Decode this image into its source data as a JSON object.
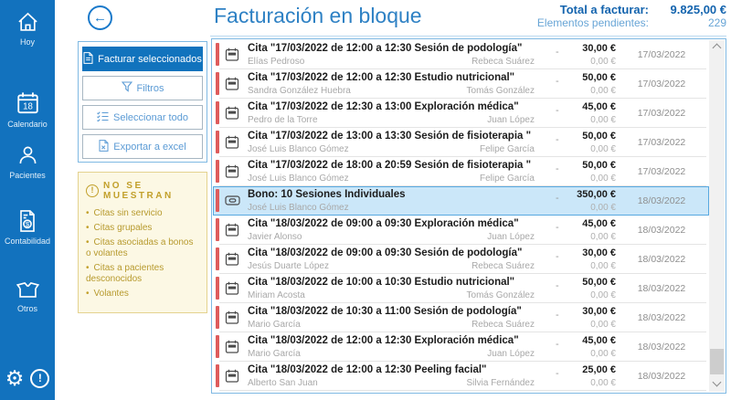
{
  "colors": {
    "sidebar_blue": "#1272BE",
    "accent_blue": "#2E81C4",
    "primary_button_blue": "#1173BD",
    "selected_row_bg": "#CBE7F9",
    "selected_row_border": "#58A9E0",
    "pending_red": "#DE5C5C",
    "warning_gold": "#C2A02B",
    "warning_bg": "#FCF8E4"
  },
  "glyphs": {
    "back_arrow": "←",
    "gear": "⚙",
    "exclamation": "!"
  },
  "sidebar": {
    "calendar_day": "18",
    "items": [
      {
        "label": "Hoy"
      },
      {
        "label": "Calendario"
      },
      {
        "label": "Pacientes"
      },
      {
        "label": "Contabilidad"
      },
      {
        "label": "Otros"
      }
    ]
  },
  "header": {
    "title": "Facturación en bloque",
    "total_label": "Total a facturar:",
    "total_value": "9.825,00 €",
    "pending_label": "Elementos pendientes:",
    "pending_value": "229"
  },
  "actions": {
    "invoice_selected": "Facturar seleccionados",
    "filters": "Filtros",
    "select_all": "Seleccionar todo",
    "export_excel": "Exportar a excel"
  },
  "warning": {
    "title": "NO SE MUESTRAN",
    "items": [
      {
        "text": "Citas sin servicio"
      },
      {
        "text": "Citas grupales"
      },
      {
        "text": "Citas asociadas a bonos o volantes"
      },
      {
        "text": "Citas a pacientes desconocidos"
      },
      {
        "text": "Volantes"
      }
    ]
  },
  "list": {
    "rows": [
      {
        "icon": "cita",
        "selected": false,
        "title": "Cita \"17/03/2022 de 12:00 a 12:30 Sesión de podología\"",
        "patient": "Elías Pedroso",
        "professional": "Rebeca Suárez",
        "dash": "-",
        "amount": "30,00 €",
        "secondary_amount": "0,00 €",
        "date": "17/03/2022"
      },
      {
        "icon": "cita",
        "selected": false,
        "title": "Cita \"17/03/2022 de 12:00 a 12:30 Estudio nutricional\"",
        "patient": "Sandra González Huebra",
        "professional": "Tomás González",
        "dash": "-",
        "amount": "50,00 €",
        "secondary_amount": "0,00 €",
        "date": "17/03/2022"
      },
      {
        "icon": "cita",
        "selected": false,
        "title": "Cita \"17/03/2022 de 12:30 a 13:00 Exploración médica\"",
        "patient": "Pedro de la Torre",
        "professional": "Juan López",
        "dash": "-",
        "amount": "45,00 €",
        "secondary_amount": "0,00 €",
        "date": "17/03/2022"
      },
      {
        "icon": "cita",
        "selected": false,
        "title": "Cita \"17/03/2022 de 13:00 a 13:30 Sesión de fisioterapia \"",
        "patient": "José Luis Blanco Gómez",
        "professional": "Felipe García",
        "dash": "-",
        "amount": "50,00 €",
        "secondary_amount": "0,00 €",
        "date": "17/03/2022"
      },
      {
        "icon": "cita",
        "selected": false,
        "title": "Cita \"17/03/2022 de 18:00 a 20:59 Sesión de fisioterapia \"",
        "patient": "José Luis Blanco Gómez",
        "professional": "Felipe García",
        "dash": "-",
        "amount": "50,00 €",
        "secondary_amount": "0,00 €",
        "date": "17/03/2022"
      },
      {
        "icon": "bono",
        "selected": true,
        "title": "Bono: 10 Sesiones Individuales",
        "patient": "José Luis Blanco Gómez",
        "professional": "",
        "dash": "-",
        "amount": "350,00 €",
        "secondary_amount": "0,00 €",
        "date": "18/03/2022"
      },
      {
        "icon": "cita",
        "selected": false,
        "title": "Cita \"18/03/2022 de 09:00 a 09:30 Exploración médica\"",
        "patient": "Javier Alonso",
        "professional": "Juan López",
        "dash": "-",
        "amount": "45,00 €",
        "secondary_amount": "0,00 €",
        "date": "18/03/2022"
      },
      {
        "icon": "cita",
        "selected": false,
        "title": "Cita \"18/03/2022 de 09:00 a 09:30 Sesión de podología\"",
        "patient": "Jesús Duarte López",
        "professional": "Rebeca Suárez",
        "dash": "-",
        "amount": "30,00 €",
        "secondary_amount": "0,00 €",
        "date": "18/03/2022"
      },
      {
        "icon": "cita",
        "selected": false,
        "title": "Cita \"18/03/2022 de 10:00 a 10:30 Estudio nutricional\"",
        "patient": "Miriam Acosta",
        "professional": "Tomás González",
        "dash": "-",
        "amount": "50,00 €",
        "secondary_amount": "0,00 €",
        "date": "18/03/2022"
      },
      {
        "icon": "cita",
        "selected": false,
        "title": "Cita \"18/03/2022 de 10:30 a 11:00 Sesión de podología\"",
        "patient": "Mario García",
        "professional": "Rebeca Suárez",
        "dash": "-",
        "amount": "30,00 €",
        "secondary_amount": "0,00 €",
        "date": "18/03/2022"
      },
      {
        "icon": "cita",
        "selected": false,
        "title": "Cita \"18/03/2022 de 12:00 a 12:30 Exploración médica\"",
        "patient": "Mario García",
        "professional": "Juan López",
        "dash": "-",
        "amount": "45,00 €",
        "secondary_amount": "0,00 €",
        "date": "18/03/2022"
      },
      {
        "icon": "cita",
        "selected": false,
        "title": "Cita \"18/03/2022 de 12:00 a 12:30 Peeling facial\"",
        "patient": "Alberto San Juan",
        "professional": "Silvia Fernández",
        "dash": "-",
        "amount": "25,00 €",
        "secondary_amount": "0,00 €",
        "date": "18/03/2022"
      }
    ]
  }
}
